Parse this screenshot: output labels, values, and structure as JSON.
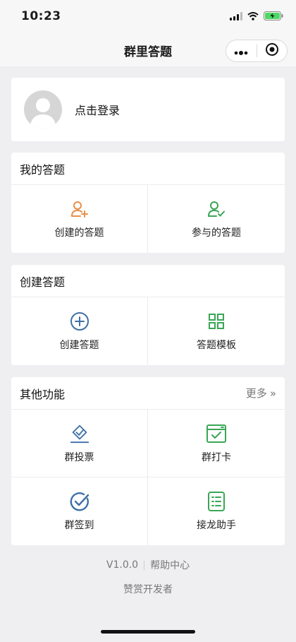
{
  "status_bar": {
    "time": "10:23"
  },
  "nav": {
    "title": "群里答题"
  },
  "login": {
    "text": "点击登录"
  },
  "my_quiz": {
    "title": "我的答题",
    "items": [
      {
        "label": "创建的答题",
        "icon": "user-add-icon",
        "color": "#e8904a"
      },
      {
        "label": "参与的答题",
        "icon": "user-check-icon",
        "color": "#3aa655"
      }
    ]
  },
  "create_quiz": {
    "title": "创建答题",
    "items": [
      {
        "label": "创建答题",
        "icon": "plus-circle-icon",
        "color": "#3f6fa8"
      },
      {
        "label": "答题模板",
        "icon": "grid-icon",
        "color": "#3aa655"
      }
    ]
  },
  "other": {
    "title": "其他功能",
    "more_label": "更多",
    "more_chevron": "»",
    "items": [
      {
        "label": "群投票",
        "icon": "vote-icon",
        "color": "#3f6fa8"
      },
      {
        "label": "群打卡",
        "icon": "checkin-icon",
        "color": "#3aa655"
      },
      {
        "label": "群签到",
        "icon": "sign-icon",
        "color": "#3f6fa8"
      },
      {
        "label": "接龙助手",
        "icon": "list-icon",
        "color": "#3aa655"
      }
    ]
  },
  "footer": {
    "version": "V1.0.0",
    "help": "帮助中心",
    "donate": "赞赏开发者"
  }
}
